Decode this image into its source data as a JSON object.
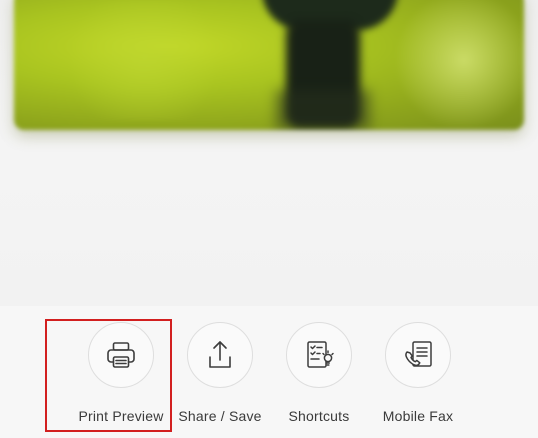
{
  "toolbar": {
    "actions": [
      {
        "label": "Print Preview",
        "icon": "printer-icon"
      },
      {
        "label": "Share / Save",
        "icon": "share-upload-icon"
      },
      {
        "label": "Shortcuts",
        "icon": "shortcuts-checklist-icon"
      },
      {
        "label": "Mobile Fax",
        "icon": "fax-phone-icon"
      }
    ]
  },
  "colors": {
    "highlight_border": "#d21f1f",
    "icon_stroke": "#3c3c3c",
    "label_text": "#3a3a3a"
  }
}
